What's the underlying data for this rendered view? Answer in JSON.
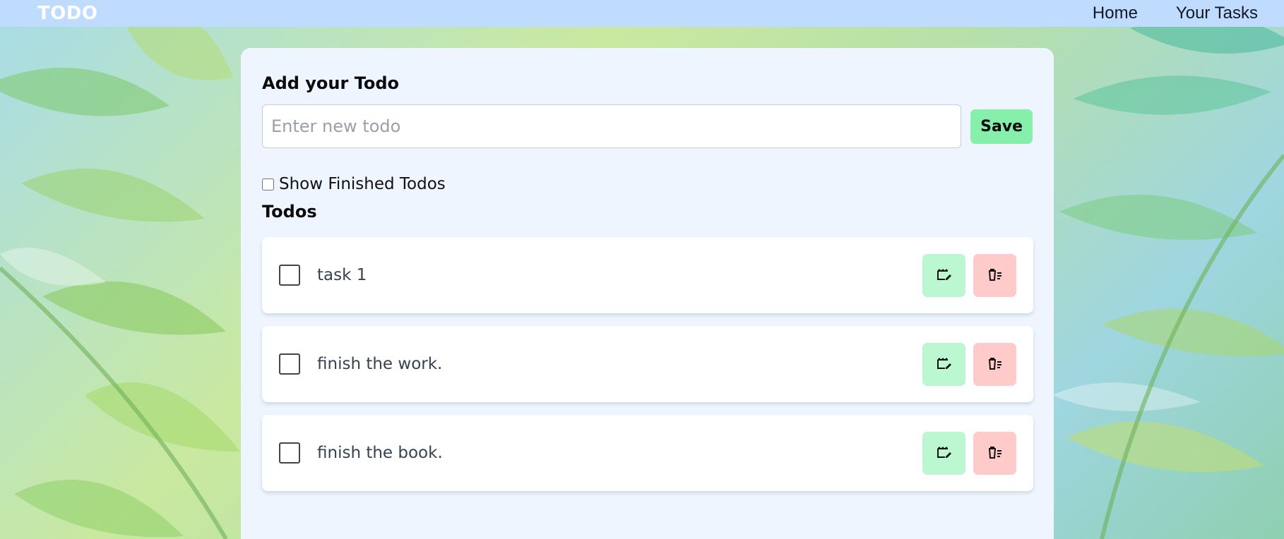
{
  "navbar": {
    "brand": "TODO",
    "links": [
      "Home",
      "Your Tasks"
    ]
  },
  "add": {
    "title": "Add your Todo",
    "placeholder": "Enter new todo",
    "value": "",
    "save_label": "Save"
  },
  "filter": {
    "show_finished_label": "Show Finished Todos",
    "checked": false
  },
  "list": {
    "title": "Todos",
    "items": [
      {
        "text": "task 1",
        "done": false
      },
      {
        "text": "finish the work.",
        "done": false
      },
      {
        "text": "finish the book.",
        "done": false
      }
    ]
  },
  "icons": {
    "edit": "edit-icon",
    "delete": "delete-icon"
  },
  "colors": {
    "navbar": "#bfdbfe",
    "panel": "#eef5ff",
    "save": "#86efac",
    "edit": "#bbf7d0",
    "delete": "#fecaca"
  }
}
